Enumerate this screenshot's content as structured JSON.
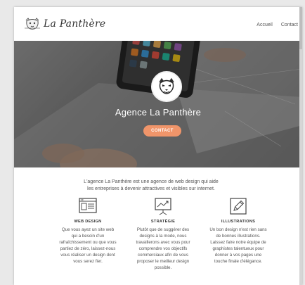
{
  "brand": {
    "name": "La Panthère"
  },
  "nav": {
    "items": [
      "Accueil",
      "Contact"
    ]
  },
  "hero": {
    "title": "Agence La Panthère",
    "cta_label": "CONTACT"
  },
  "intro": {
    "line1": "L'agence La Panthère est une agence de web design qui aide",
    "line2": "les entreprises à devenir attractives et visibles sur internet."
  },
  "features": [
    {
      "icon": "web-design-icon",
      "title": "WEB DESIGN",
      "lines": [
        "Que vous ayez un site web",
        "qui a besoin d'un",
        "rafraîchissement ou que vous",
        "partiez de zéro, laissez-nous",
        "vous réaliser un design dont",
        "vous serez fier."
      ]
    },
    {
      "icon": "strategy-icon",
      "title": "STRATÉGIE",
      "lines": [
        "Plutôt que de suggérer des",
        "designs à la mode, nous",
        "travaillerons avec vous pour",
        "comprendre vos objectifs",
        "commerciaux afin de vous",
        "proposer le meilleur design",
        "possible."
      ]
    },
    {
      "icon": "illustration-icon",
      "title": "ILLUSTRATIONS",
      "lines": [
        "Un bon design n'est rien sans",
        "de bonnes illustrations.",
        "Laissez faire notre équipe de",
        "graphistes talentueux pour",
        "donner à vos pages une",
        "touche finale d'élégance."
      ]
    }
  ],
  "colors": {
    "accent": "#f0956a",
    "text": "#555555"
  }
}
